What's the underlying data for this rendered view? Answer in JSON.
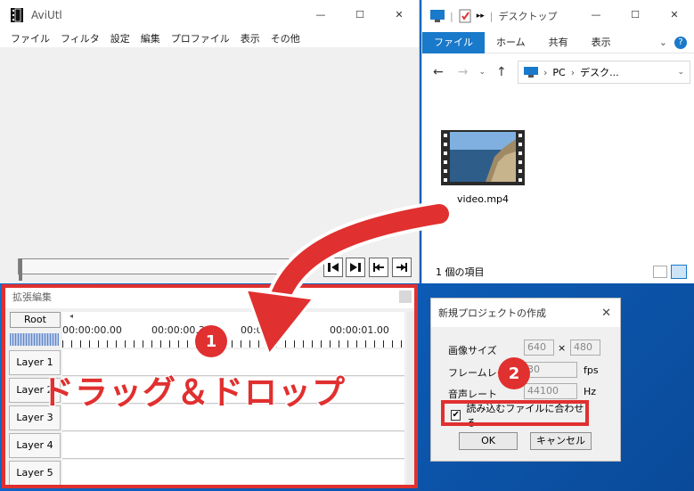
{
  "aviutl": {
    "title": "AviUtl",
    "menu": [
      "ファイル",
      "フィルタ",
      "設定",
      "編集",
      "プロファイル",
      "表示",
      "その他"
    ]
  },
  "explorer": {
    "title": "デスクトップ",
    "tabs": [
      "ファイル",
      "ホーム",
      "共有",
      "表示"
    ],
    "breadcrumb": [
      "PC",
      "デスク..."
    ],
    "file_name": "video.mp4",
    "status": "1 個の項目"
  },
  "timeline": {
    "title": "拡張編集",
    "root_label": "Root",
    "time_labels": [
      "00:00:00.00",
      "00:00:00.3",
      "00:00",
      "00:00:01.00"
    ],
    "layers": [
      "Layer 1",
      "Layer 2",
      "Layer 3",
      "Layer 4",
      "Layer 5"
    ]
  },
  "dialog": {
    "title": "新規プロジェクトの作成",
    "image_size_label": "画像サイズ",
    "width": "640",
    "times": "×",
    "height": "480",
    "framerate_label": "フレームレー",
    "framerate_value": "30",
    "fps_unit": "fps",
    "audio_rate_label": "音声レート",
    "audio_rate_value": "44100",
    "hz_unit": "Hz",
    "fit_checkbox_label": "読み込むファイルに合わせる",
    "fit_checked": true,
    "ok_label": "OK",
    "cancel_label": "キャンセル"
  },
  "annotations": {
    "step1": "1",
    "step2": "2",
    "caption": "ドラッグ＆ドロップ",
    "accent_color": "#e0302f"
  },
  "icons": [
    "film-icon",
    "minimize-icon",
    "maximize-icon",
    "close-icon",
    "back-icon",
    "forward-icon",
    "up-icon",
    "pc-icon",
    "video-thumbnail-icon",
    "details-view-icon",
    "large-icons-view-icon"
  ]
}
